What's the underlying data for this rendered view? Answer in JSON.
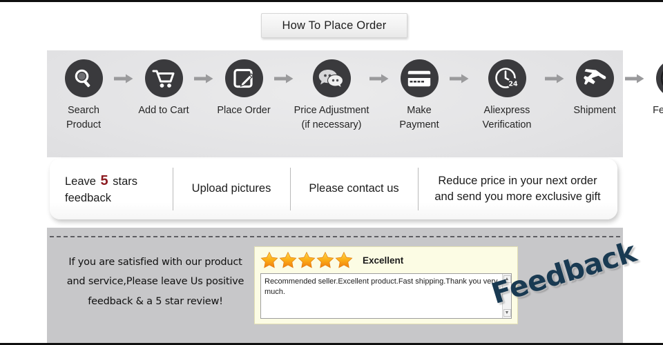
{
  "title": {
    "text": "How To Place Order"
  },
  "steps": [
    {
      "icon": "magnifier-icon",
      "label_line1": "Search",
      "label_line2": "Product"
    },
    {
      "icon": "shopping-cart-icon",
      "label_line1": "Add to Cart",
      "label_line2": ""
    },
    {
      "icon": "edit-note-icon",
      "label_line1": "Place Order",
      "label_line2": ""
    },
    {
      "icon": "chat-bubbles-icon",
      "label_line1": "Price Adjustment",
      "label_line2": "(if necessary)"
    },
    {
      "icon": "credit-card-icon",
      "label_line1": "Make",
      "label_line2": "Payment"
    },
    {
      "icon": "clock-24-icon",
      "label_line1": "Aliexpress",
      "label_line2": "Verification"
    },
    {
      "icon": "airplane-icon",
      "label_line1": "Shipment",
      "label_line2": ""
    },
    {
      "icon": "thumbs-up-icon",
      "label_line1": "Feedback",
      "label_line2": ""
    }
  ],
  "arrow_icon": "arrow-right-icon",
  "promises": [
    {
      "pre": "Leave ",
      "highlight": "5",
      "post": " stars feedback"
    },
    {
      "text": "Upload pictures"
    },
    {
      "text": "Please contact us"
    },
    {
      "line1": "Reduce  price in your next order",
      "line2": "and send you more exclusive gift"
    }
  ],
  "satisfaction": {
    "line1": "If you are satisfied with our product",
    "line2": "and service,Please leave Us positive",
    "line3": "feedback & a 5 star review!"
  },
  "review": {
    "star_count": 5,
    "rating_label": "Excellent",
    "text": "Recommended seller.Excellent product.Fast shipping.Thank you very much.",
    "scroll_up_glyph": "▲",
    "scroll_down_glyph": "▼"
  },
  "watermark": {
    "text": "Feedback"
  },
  "colors": {
    "disc": "#3a3a3d",
    "arrow": "#9a9a9c",
    "panel_bg": "#e3e3e5",
    "band_bg": "#c7c7c9",
    "highlight_five": "#8c1b20",
    "star_top": "#ffd24d",
    "star_bottom": "#ef7d10",
    "review_bg": "#fcfce4",
    "watermark": "#193a52"
  }
}
